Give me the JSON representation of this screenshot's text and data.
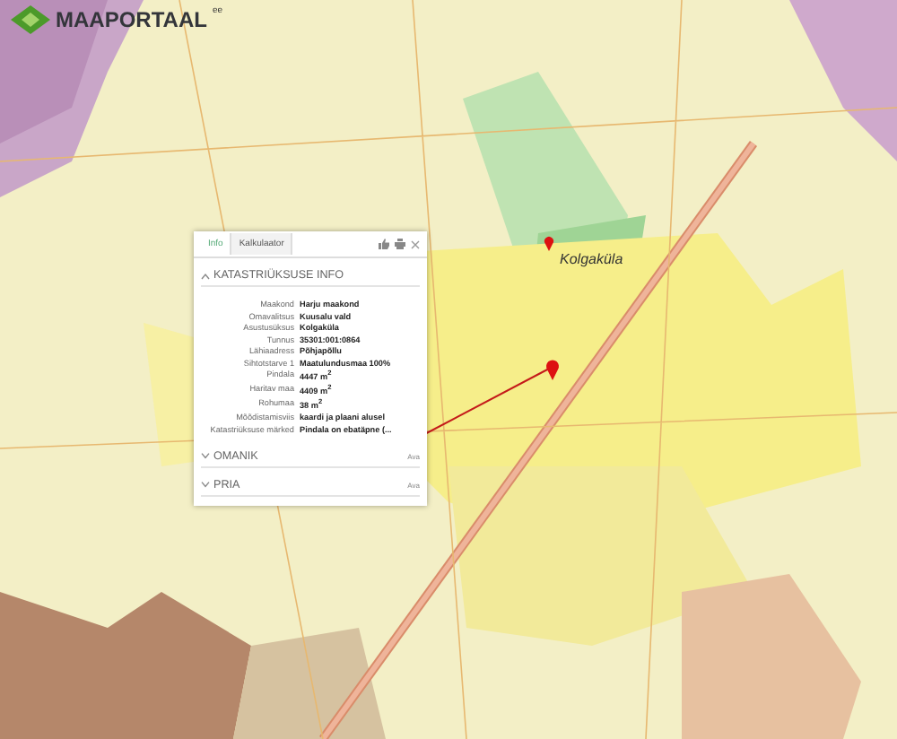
{
  "logo": {
    "name": "MAAPORTAAL",
    "suffix": "ee"
  },
  "map_labels": [
    "Kolgaküla"
  ],
  "popup": {
    "tabs": [
      {
        "label": "Info",
        "selected": true
      },
      {
        "label": "Kalkulaator",
        "selected": false
      }
    ],
    "section": {
      "title": "KATASTRIÜKSUSE INFO",
      "expanded": true,
      "rows": [
        {
          "label": "Maakond",
          "value": "Harju maakond"
        },
        {
          "label": "Omavalitsus",
          "value": "Kuusalu vald"
        },
        {
          "label": "Asustusüksus",
          "value": "Kolgaküla"
        },
        {
          "label": "Tunnus",
          "value": "35301:001:0864"
        },
        {
          "label": "Lähiaadress",
          "value": "Põhjapõllu"
        },
        {
          "label": "Sihtotstarve 1",
          "value": "Maatulundusmaa 100%"
        },
        {
          "label": "Pindala",
          "value": "4447 m$^{2}$"
        },
        {
          "label": "Haritav maa",
          "value": "4409 m$^{2}$"
        },
        {
          "label": "Rohumaa",
          "value": "38 m$^{2}$"
        },
        {
          "label": "Mõõdistamisviis",
          "value": "kaardi ja plaani alusel"
        },
        {
          "label": "Katastriüksuse märked",
          "value": "Pindala on ebatäpne (..."
        }
      ]
    },
    "collapsed": [
      {
        "title": "OMANIK",
        "action": "Ava",
        "expanded": false
      },
      {
        "title": "PRIA",
        "action": "Ava",
        "expanded": false
      }
    ]
  }
}
